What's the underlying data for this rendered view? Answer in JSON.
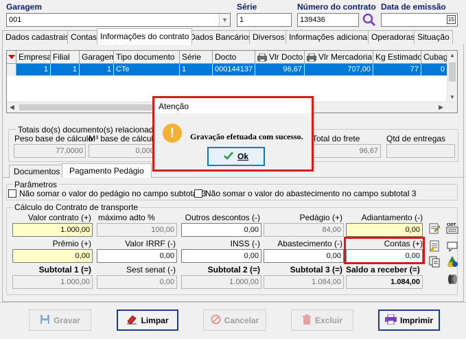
{
  "top": {
    "garagem_label": "Garagem",
    "garagem_value": "001",
    "serie_label": "Série",
    "serie_value": "1",
    "numero_label": "Número do contrato",
    "numero_value": "139436",
    "emissao_label": "Data de emissão",
    "emissao_icon": "15"
  },
  "tabs": [
    {
      "label": "Dados cadastrais"
    },
    {
      "label": "Contas"
    },
    {
      "label": "Informações do contrato"
    },
    {
      "label": "Dados Bancários"
    },
    {
      "label": "Diversos"
    },
    {
      "label": "Informações adicionais"
    },
    {
      "label": "Operadoras"
    },
    {
      "label": "Situação"
    }
  ],
  "grid": {
    "columns": [
      "Empresa",
      "Filial",
      "Garagem",
      "Tipo documento",
      "Série",
      "Docto",
      "Vlr Docto",
      "Vlr Mercadoria",
      "Kg Estimado",
      "Cubagem"
    ],
    "row": [
      "1",
      "1",
      "1",
      "CTe",
      "1",
      "000144137",
      "96,67",
      "707,00",
      "77",
      "0"
    ]
  },
  "totais": {
    "group_label": "Totais do(s) documento(s) relacionado(s)",
    "peso_label": "Peso base de cálculo",
    "peso_value": "77,0000",
    "m3_label": "M³ base de cálculo",
    "m3_value": "0,000",
    "total_frete_label": "Total do frete",
    "total_frete_value": "96,67",
    "qtd_label": "Qtd de entregas",
    "qtd_value": ""
  },
  "subtabs": [
    {
      "label": "Documentos"
    },
    {
      "label": "Pagamento Pedágio"
    }
  ],
  "parametros": {
    "group_label": "Parâmetros",
    "chk1": "Não somar o valor do pedágio no campo subtotal 3",
    "chk2": "Não somar o valor do abastecimento no campo subtotal 3"
  },
  "calculo": {
    "group_label": "Cálculo do Contrato de transporte",
    "row1": [
      {
        "label": "Valor contrato (+)",
        "value": "1.000,00"
      },
      {
        "label": "máximo adto %",
        "value": "100,00"
      },
      {
        "label": "Outros descontos (-)",
        "value": "0,00"
      },
      {
        "label": "Pedágio (+)",
        "value": "84,00"
      },
      {
        "label": "Adiantamento (-)",
        "value": "0,00"
      }
    ],
    "row2": [
      {
        "label": "Prêmio (+)",
        "value": "0,00"
      },
      {
        "label": "Valor IRRF (-)",
        "value": "0,00"
      },
      {
        "label": "INSS (-)",
        "value": "0,00"
      },
      {
        "label": "Abastecimento (-)",
        "value": "0,00"
      },
      {
        "label": "Contas (+)",
        "value": "0,00"
      }
    ],
    "row3": [
      {
        "label": "Subtotal 1 (=)",
        "value": "1.000,00"
      },
      {
        "label": "Sest senat (-)",
        "value": "0,00"
      },
      {
        "label": "Subtotal 2 (=)",
        "value": "1.000,00"
      },
      {
        "label": "Subtotal 3 (=)",
        "value": "1.084,00"
      },
      {
        "label": "Saldo a receber (=)",
        "value": "1.084,00"
      }
    ]
  },
  "dialog": {
    "title": "Atenção",
    "message": "Gravação efetuada com sucesso.",
    "ok": "Ok"
  },
  "buttons": {
    "gravar": "Gravar",
    "limpar": "Limpar",
    "cancelar": "Cancelar",
    "excluir": "Excluir",
    "imprimir": "Imprimir"
  },
  "colors": {
    "accent": "#0078d7",
    "highlight_red": "#d21d1d",
    "header_blue": "#0f1e6e",
    "yellow_field": "#ffffc8"
  }
}
